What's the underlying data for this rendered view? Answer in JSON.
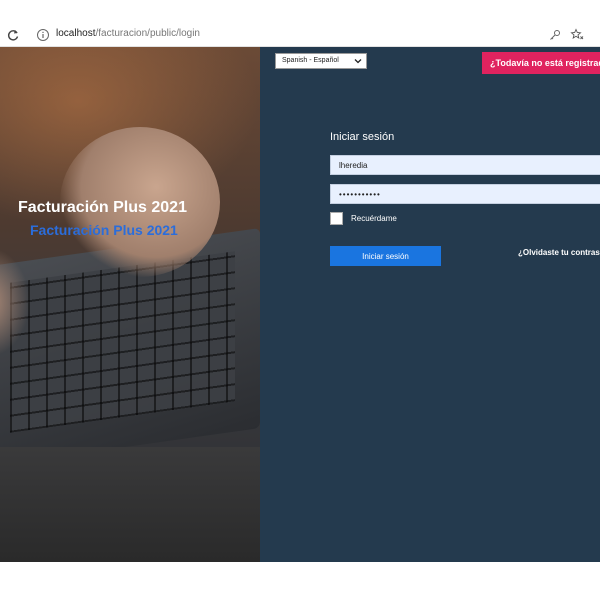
{
  "browser": {
    "url_host": "localhost",
    "url_path": "/facturacion/public/login",
    "icons": [
      "reload-icon",
      "info-icon",
      "key-icon",
      "favorites-star-icon"
    ]
  },
  "hero": {
    "title": "Facturación Plus 2021",
    "subtitle": "Facturación Plus 2021"
  },
  "panel": {
    "language_selected": "Spanish - Español",
    "register_label": "¿Todavía no está registrado?",
    "login_heading": "Iniciar sesión",
    "username_value": "lheredia",
    "password_value": "•••••••••••",
    "remember_label": "Recuérdame",
    "login_button": "Iniciar sesión",
    "forgot_link": "¿Olvidaste tu contraseña?"
  },
  "colors": {
    "panel_bg": "#243a4e",
    "register_btn": "#e0235f",
    "login_btn": "#1a75e0",
    "subtitle": "#2b6ddb"
  }
}
